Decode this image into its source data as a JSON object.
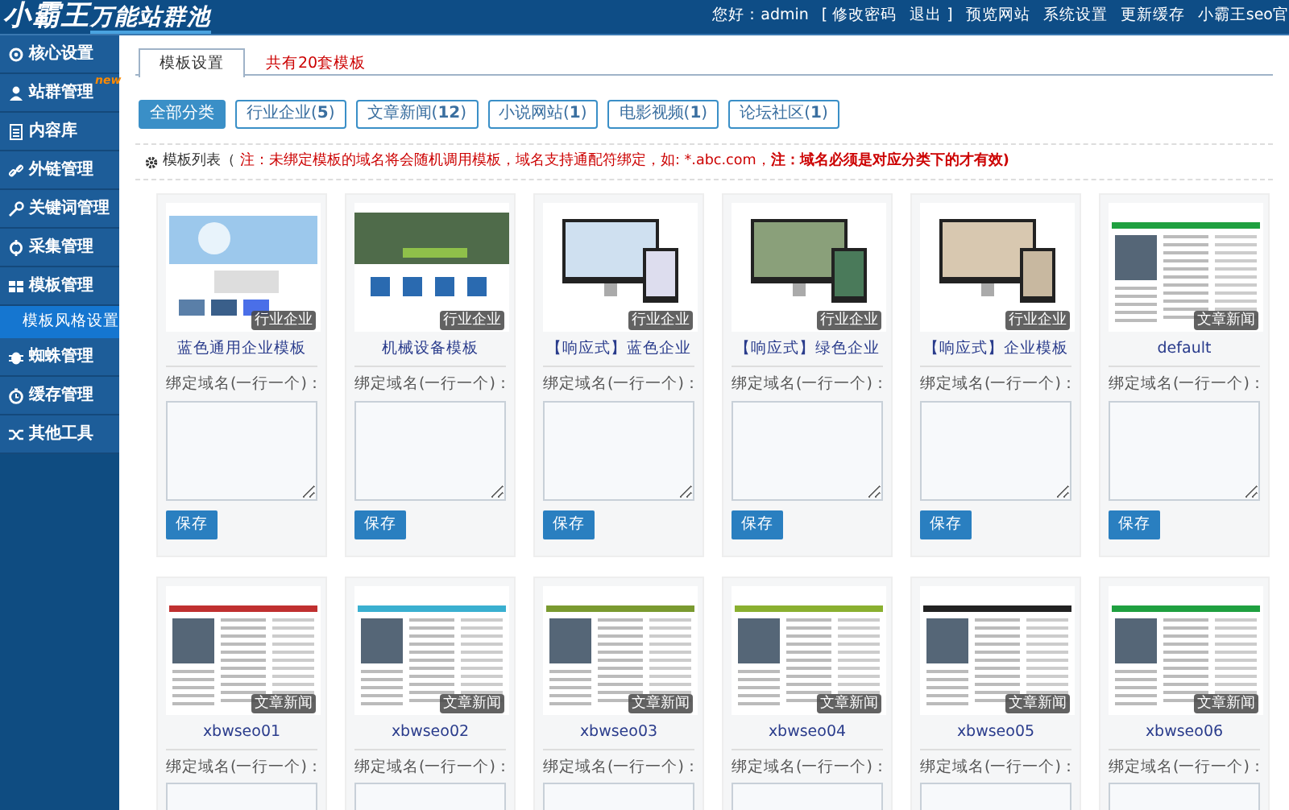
{
  "header": {
    "logo": {
      "main": "小霸王",
      "sub": "万能站群池"
    },
    "greeting": "您好：admin",
    "links": [
      {
        "label": "[ 修改密码"
      },
      {
        "label": "退出 ]"
      },
      {
        "label": "预览网站"
      },
      {
        "label": "系统设置"
      },
      {
        "label": "更新缓存"
      },
      {
        "label": "小霸王seo官"
      }
    ]
  },
  "sidebar": {
    "items": [
      {
        "label": "核心设置",
        "selected": false
      },
      {
        "label": "站群管理",
        "badge": "new",
        "selected": false
      },
      {
        "label": "内容库",
        "selected": false
      },
      {
        "label": "外链管理",
        "selected": false
      },
      {
        "label": "关键词管理",
        "selected": false
      },
      {
        "label": "采集管理",
        "selected": false
      },
      {
        "label": "模板管理",
        "selected": false,
        "children": [
          {
            "label": "模板风格设置",
            "selected": true
          }
        ]
      },
      {
        "label": "蜘蛛管理",
        "selected": false
      },
      {
        "label": "缓存管理",
        "selected": false
      },
      {
        "label": "其他工具",
        "selected": false
      }
    ]
  },
  "tabs": [
    {
      "label": "模板设置",
      "selected": true
    },
    {
      "label": "共有20套模板",
      "selected": false
    }
  ],
  "filters": [
    {
      "label": "全部分类",
      "selected": true
    },
    {
      "label": "行业企业(**5**)",
      "selected": false
    },
    {
      "label": "文章新闻(**12**)",
      "selected": false
    },
    {
      "label": "小说网站(**1**)",
      "selected": false
    },
    {
      "label": "电影视频(**1**)",
      "selected": false
    },
    {
      "label": "论坛社区(**1**)",
      "selected": false
    }
  ],
  "notice": {
    "title": "模板列表（",
    "text": "注：未绑定模板的域名将会随机调用模板，域名支持通配符绑定，如: *.abc.com，**注：域名必须是对应分类下的才有效)**"
  },
  "templates": [
    {
      "name": "蓝色通用企业模板",
      "category": "行业企业",
      "field_label": "绑定域名(一行一个)：",
      "button": "保存"
    },
    {
      "name": "机械设备模板",
      "category": "行业企业",
      "field_label": "绑定域名(一行一个)：",
      "button": "保存"
    },
    {
      "name": "【响应式】蓝色企业",
      "category": "行业企业",
      "field_label": "绑定域名(一行一个)：",
      "button": "保存"
    },
    {
      "name": "【响应式】绿色企业",
      "category": "行业企业",
      "field_label": "绑定域名(一行一个)：",
      "button": "保存"
    },
    {
      "name": "【响应式】企业模板",
      "category": "行业企业",
      "field_label": "绑定域名(一行一个)：",
      "button": "保存"
    },
    {
      "name": "default",
      "category": "文章新闻",
      "field_label": "绑定域名(一行一个)：",
      "button": "保存"
    },
    {
      "name": "xbwseo01",
      "category": "文章新闻",
      "field_label": "绑定域名(一行一个)："
    },
    {
      "name": "xbwseo02",
      "category": "文章新闻",
      "field_label": "绑定域名(一行一个)："
    },
    {
      "name": "xbwseo03",
      "category": "文章新闻",
      "field_label": "绑定域名(一行一个)："
    },
    {
      "name": "xbwseo04",
      "category": "文章新闻",
      "field_label": "绑定域名(一行一个)："
    },
    {
      "name": "xbwseo05",
      "category": "文章新闻",
      "field_label": "绑定域名(一行一个)："
    },
    {
      "name": "xbwseo06",
      "category": "文章新闻",
      "field_label": "绑定域名(一行一个)："
    }
  ]
}
